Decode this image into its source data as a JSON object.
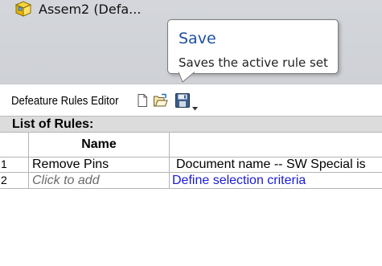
{
  "tree": {
    "assembly_label": "Assem2 (Defa...",
    "assembly_icon": "assembly-icon"
  },
  "tooltip": {
    "title": "Save",
    "description": "Saves the active rule set"
  },
  "editor": {
    "title": "Defeature Rules Editor",
    "toolbar": {
      "new_icon": "new-document-icon",
      "open_icon": "open-folder-icon",
      "save_icon": "save-icon",
      "dropdown_icon": "chevron-down-icon"
    }
  },
  "rules": {
    "header": "List of Rules:",
    "columns": [
      "",
      "Name",
      ""
    ],
    "rows": [
      {
        "num": "1",
        "name": "Remove Pins",
        "criteria": "Document name -- SW Special is"
      },
      {
        "num": "2",
        "name": "Click to add",
        "criteria": "Define selection criteria"
      }
    ]
  },
  "colors": {
    "tooltip_title": "#1f4ea6",
    "link": "#1a1ad6",
    "header_bg": "#dcdcdc"
  }
}
